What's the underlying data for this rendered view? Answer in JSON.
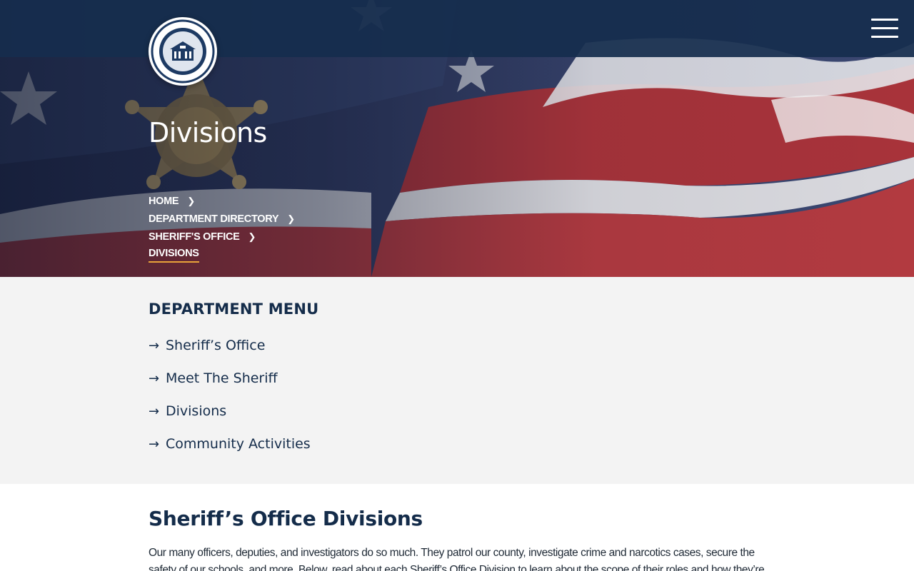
{
  "header": {
    "logo_alt": "Fairfield County South Carolina seal",
    "menu_icon": "hamburger-menu-icon"
  },
  "hero": {
    "title": "Divisions",
    "breadcrumbs": [
      "HOME",
      "DEPARTMENT DIRECTORY",
      "SHERIFF'S OFFICE",
      "DIVISIONS"
    ]
  },
  "department_menu": {
    "title": "DEPARTMENT MENU",
    "items": [
      "Sheriff’s Office",
      "Meet The Sheriff",
      "Divisions",
      "Community Activities"
    ]
  },
  "content": {
    "title": "Sheriff’s Office Divisions",
    "paragraph": "Our many officers, deputies, and investigators do so much. They patrol our county, investigate crime and narcotics cases, secure the safety of our schools, and more. Below, read about each Sheriff’s Office Division to learn about the scope of their roles and how they’re working"
  },
  "colors": {
    "navy": "#142c4a",
    "accent_underline": "#e8a33a",
    "menu_bg": "#f3f3f3"
  }
}
